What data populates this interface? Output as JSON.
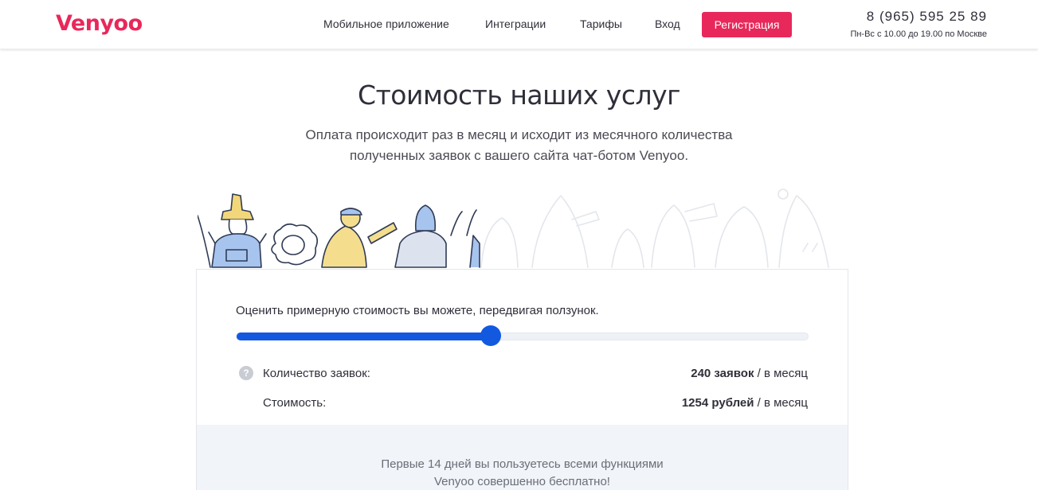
{
  "header": {
    "logo": "Venyoo",
    "nav": [
      {
        "label": "Мобильное приложение"
      },
      {
        "label": "Интеграции"
      },
      {
        "label": "Тарифы"
      },
      {
        "label": "Вход"
      }
    ],
    "register_label": "Регистрация",
    "phone": "8 (965) 595 25 89",
    "hours": "Пн-Вс с 10.00 до 19.00 по Москве"
  },
  "hero": {
    "title": "Стоимость наших услуг",
    "subtitle_line1": "Оплата происходит раз в месяц и исходит из месячного количества",
    "subtitle_line2": "полученных заявок с вашего сайта чат-ботом Venyoo."
  },
  "calculator": {
    "slider_label": "Оценить примерную стоимость вы можете, передвигая ползунок.",
    "slider_fraction": 0.44,
    "help_icon_glyph": "?",
    "requests_label": "Количество заявок:",
    "requests_value": "240 заявок",
    "requests_unit": " / в месяц",
    "cost_label": "Стоимость:",
    "cost_value": "1254 рублей",
    "cost_unit": " / в месяц",
    "footer_line1": "Первые 14 дней вы пользуетесь всеми функциями",
    "footer_line2": "Venyoo совершенно бесплатно!"
  },
  "colors": {
    "brand": "#e8285a",
    "slider": "#1259e0"
  }
}
